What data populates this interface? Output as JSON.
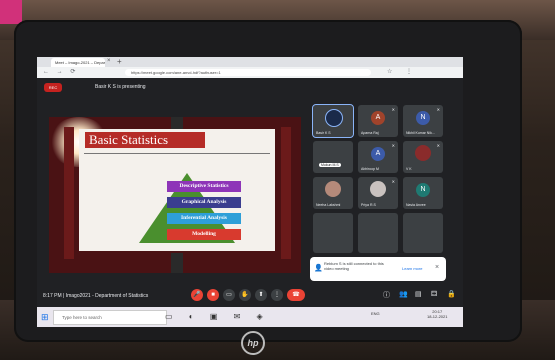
{
  "browser": {
    "tab_title": "Meet – Imago-2021 – Department of Statistics",
    "url": "https://meet.google.com/ane-anvd-hdf?authuser=1",
    "nav_icons": "← → ⟳"
  },
  "meet": {
    "rec_label": "REC",
    "presenting_text": "Basir K S is presenting",
    "meeting_info": "8:17 PM | Imago2021 - Department of Statistics"
  },
  "slide": {
    "title": "Basic Statistics",
    "levels": [
      "Descriptive Statistics",
      "Graphical Analysis",
      "Inferential Analysis",
      "Modelling"
    ]
  },
  "participants": [
    {
      "name": "Basir K S",
      "initial": "",
      "color": "#1a2a4a",
      "active": true
    },
    {
      "name": "Aparna Raj",
      "initial": "A",
      "color": "#a0432b"
    },
    {
      "name": "Nikhil Kumar Nik...",
      "initial": "N",
      "color": "#3c5ba9"
    },
    {
      "name": "",
      "initial": "",
      "color": "#3c4043",
      "tag": "Mukun M.S"
    },
    {
      "name": "Abhiroop M",
      "initial": "A",
      "color": "#3c5ba9"
    },
    {
      "name": "V K",
      "initial": "",
      "color": "#8a2b2b"
    },
    {
      "name": "Neeha Lakshmi",
      "initial": "",
      "color": "#b58a7a"
    },
    {
      "name": "Priya R.S",
      "initial": "",
      "color": "#c9c2bf"
    },
    {
      "name": "Navia Anvee",
      "initial": "N",
      "color": "#1f7a72"
    }
  ],
  "notification": {
    "text": "Reblum S is still connected to this video meeting",
    "link": "Learn more",
    "close": "×"
  },
  "taskbar": {
    "search_placeholder": "Type here to search",
    "tray_text": "ENG",
    "clock_time": "20:17",
    "clock_date": "18-12-2021"
  },
  "brand": {
    "logo": "hp"
  }
}
